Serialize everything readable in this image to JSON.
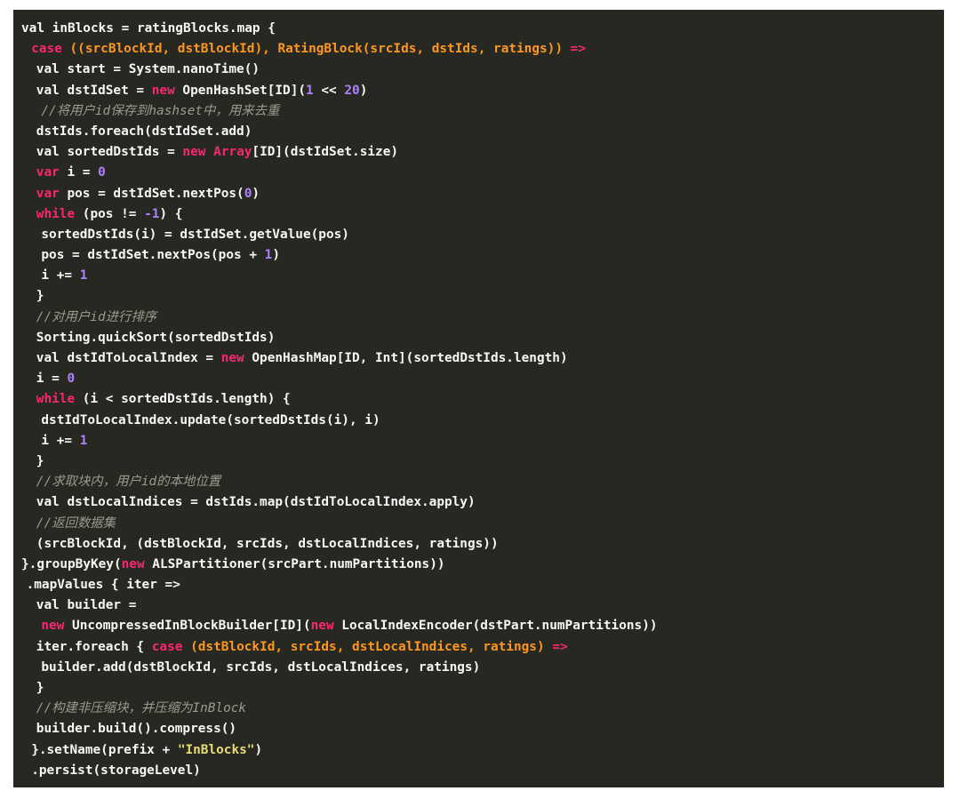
{
  "code": {
    "lines": [
      {
        "indent": 0,
        "tokens": [
          [
            "plain",
            "val inBlocks = ratingBlocks.map {"
          ]
        ]
      },
      {
        "indent": 2,
        "tokens": [
          [
            "kw",
            "case "
          ],
          [
            "arg",
            "((srcBlockId, dstBlockId), RatingBlock(srcIds, dstIds, ratings)) "
          ],
          [
            "kw",
            "=>"
          ]
        ]
      },
      {
        "indent": 3,
        "tokens": [
          [
            "plain",
            "val start = System.nanoTime()"
          ]
        ]
      },
      {
        "indent": 3,
        "tokens": [
          [
            "plain",
            "val dstIdSet = "
          ],
          [
            "kw",
            "new "
          ],
          [
            "plain",
            "OpenHashSet[ID]("
          ],
          [
            "num",
            "1"
          ],
          [
            "plain",
            " << "
          ],
          [
            "num",
            "20"
          ],
          [
            "plain",
            ")"
          ]
        ]
      },
      {
        "indent": 4,
        "tokens": [
          [
            "cmt",
            "//将用户id保存到hashset中，用来去重"
          ]
        ]
      },
      {
        "indent": 3,
        "tokens": [
          [
            "plain",
            "dstIds.foreach(dstIdSet.add)"
          ]
        ]
      },
      {
        "indent": 3,
        "tokens": [
          [
            "plain",
            "val sortedDstIds = "
          ],
          [
            "kw",
            "new Array"
          ],
          [
            "plain",
            "[ID](dstIdSet.size)"
          ]
        ]
      },
      {
        "indent": 3,
        "tokens": [
          [
            "kw",
            "var "
          ],
          [
            "plain",
            "i = "
          ],
          [
            "num",
            "0"
          ]
        ]
      },
      {
        "indent": 3,
        "tokens": [
          [
            "kw",
            "var "
          ],
          [
            "plain",
            "pos = dstIdSet.nextPos("
          ],
          [
            "num",
            "0"
          ],
          [
            "plain",
            ")"
          ]
        ]
      },
      {
        "indent": 3,
        "tokens": [
          [
            "kw",
            "while "
          ],
          [
            "plain",
            "(pos != "
          ],
          [
            "num",
            "-1"
          ],
          [
            "plain",
            ") {"
          ]
        ]
      },
      {
        "indent": 4,
        "tokens": [
          [
            "plain",
            "sortedDstIds(i) = dstIdSet.getValue(pos)"
          ]
        ]
      },
      {
        "indent": 4,
        "tokens": [
          [
            "plain",
            "pos = dstIdSet.nextPos(pos + "
          ],
          [
            "num",
            "1"
          ],
          [
            "plain",
            ")"
          ]
        ]
      },
      {
        "indent": 4,
        "tokens": [
          [
            "plain",
            "i += "
          ],
          [
            "num",
            "1"
          ]
        ]
      },
      {
        "indent": 3,
        "tokens": [
          [
            "plain",
            "}"
          ]
        ]
      },
      {
        "indent": 3,
        "tokens": [
          [
            "cmt",
            "//对用户id进行排序"
          ]
        ]
      },
      {
        "indent": 3,
        "tokens": [
          [
            "plain",
            "Sorting.quickSort(sortedDstIds)"
          ]
        ]
      },
      {
        "indent": 3,
        "tokens": [
          [
            "plain",
            "val dstIdToLocalIndex = "
          ],
          [
            "kw",
            "new "
          ],
          [
            "plain",
            "OpenHashMap[ID, Int](sortedDstIds.length)"
          ]
        ]
      },
      {
        "indent": 3,
        "tokens": [
          [
            "plain",
            "i = "
          ],
          [
            "num",
            "0"
          ]
        ]
      },
      {
        "indent": 3,
        "tokens": [
          [
            "kw",
            "while "
          ],
          [
            "plain",
            "(i < sortedDstIds.length) {"
          ]
        ]
      },
      {
        "indent": 4,
        "tokens": [
          [
            "plain",
            "dstIdToLocalIndex.update(sortedDstIds(i), i)"
          ]
        ]
      },
      {
        "indent": 4,
        "tokens": [
          [
            "plain",
            "i += "
          ],
          [
            "num",
            "1"
          ]
        ]
      },
      {
        "indent": 3,
        "tokens": [
          [
            "plain",
            "}"
          ]
        ]
      },
      {
        "indent": 3,
        "tokens": [
          [
            "cmt",
            "//求取块内，用户id的本地位置"
          ]
        ]
      },
      {
        "indent": 3,
        "tokens": [
          [
            "plain",
            "val dstLocalIndices = dstIds.map(dstIdToLocalIndex.apply)"
          ]
        ]
      },
      {
        "indent": 3,
        "tokens": [
          [
            "cmt",
            "//返回数据集"
          ]
        ]
      },
      {
        "indent": 3,
        "tokens": [
          [
            "plain",
            "(srcBlockId, (dstBlockId, srcIds, dstLocalIndices, ratings))"
          ]
        ]
      },
      {
        "indent": 0,
        "tokens": [
          [
            "plain",
            "}.groupByKey("
          ],
          [
            "kw",
            "new "
          ],
          [
            "plain",
            "ALSPartitioner(srcPart.numPartitions))"
          ]
        ]
      },
      {
        "indent": 1,
        "tokens": [
          [
            "plain",
            ".mapValues { iter =>"
          ]
        ]
      },
      {
        "indent": 3,
        "tokens": [
          [
            "plain",
            "val builder ="
          ]
        ]
      },
      {
        "indent": 4,
        "tokens": [
          [
            "kw",
            "new "
          ],
          [
            "plain",
            "UncompressedInBlockBuilder[ID]("
          ],
          [
            "kw",
            "new "
          ],
          [
            "plain",
            "LocalIndexEncoder(dstPart.numPartitions))"
          ]
        ]
      },
      {
        "indent": 3,
        "tokens": [
          [
            "plain",
            "iter.foreach { "
          ],
          [
            "kw",
            "case "
          ],
          [
            "arg",
            "(dstBlockId, srcIds, dstLocalIndices, ratings) "
          ],
          [
            "kw",
            "=>"
          ]
        ]
      },
      {
        "indent": 4,
        "tokens": [
          [
            "plain",
            "builder.add(dstBlockId, srcIds, dstLocalIndices, ratings)"
          ]
        ]
      },
      {
        "indent": 3,
        "tokens": [
          [
            "plain",
            "}"
          ]
        ]
      },
      {
        "indent": 3,
        "tokens": [
          [
            "cmt",
            "//构建非压缩块，并压缩为InBlock"
          ]
        ]
      },
      {
        "indent": 3,
        "tokens": [
          [
            "plain",
            "builder.build().compress()"
          ]
        ]
      },
      {
        "indent": 2,
        "tokens": [
          [
            "plain",
            "}.setName(prefix + "
          ],
          [
            "str",
            "\"InBlocks\""
          ],
          [
            "plain",
            ")"
          ]
        ]
      },
      {
        "indent": 2,
        "tokens": [
          [
            "plain",
            ".persist(storageLevel)"
          ]
        ]
      }
    ]
  }
}
